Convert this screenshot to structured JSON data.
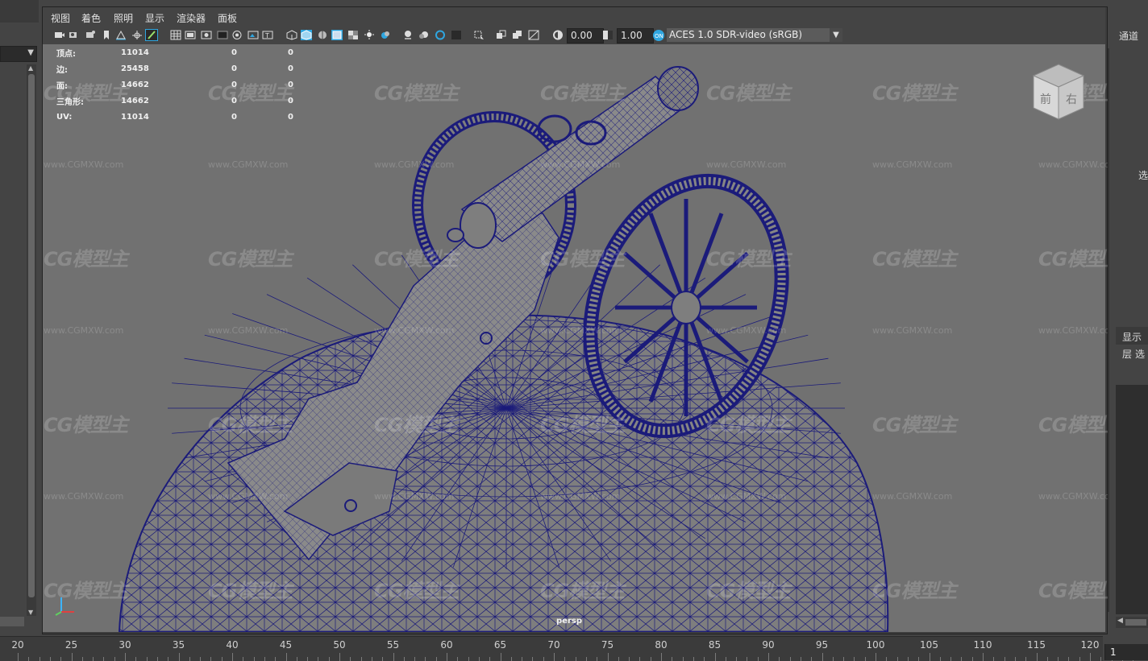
{
  "menu": [
    "视图",
    "着色",
    "照明",
    "显示",
    "渲染器",
    "面板"
  ],
  "toolbar": {
    "exposure": "0.00",
    "gamma": "1.00",
    "color_space": "ACES 1.0 SDR-video (sRGB)",
    "icons": [
      "camera-icon",
      "camera-attr-icon",
      "camera-bookmark-icon",
      "bookmark-icon",
      "image-plane-icon",
      "pivot-icon",
      "grease-pencil-icon",
      "grid-icon",
      "film-gate-icon",
      "resolution-gate-icon",
      "gate-mask-icon",
      "field-chart-icon",
      "safe-action-icon",
      "safe-title-icon",
      "wireframe-icon",
      "smooth-shade-icon",
      "wireframe-on-shaded-icon",
      "textured-icon",
      "use-all-lights-icon",
      "shadows-icon",
      "screen-space-ao-icon",
      "motion-blur-icon",
      "multisample-aa-icon",
      "depth-of-field-icon",
      "isolate-select-icon",
      "xray-icon",
      "xray-active-icon",
      "xray-joints-icon",
      "backface-icon",
      "exposure-icon",
      "gamma-icon",
      "color-management-icon"
    ]
  },
  "hud": {
    "rows": [
      {
        "label": "顶点:",
        "v1": "11014",
        "v2": "0",
        "v3": "0"
      },
      {
        "label": "边:",
        "v1": "25458",
        "v2": "0",
        "v3": "0"
      },
      {
        "label": "面:",
        "v1": "14662",
        "v2": "0",
        "v3": "0"
      },
      {
        "label": "三角形:",
        "v1": "14662",
        "v2": "0",
        "v3": "0"
      },
      {
        "label": "UV:",
        "v1": "11014",
        "v2": "0",
        "v3": "0"
      }
    ]
  },
  "viewport": {
    "camera_label": "persp"
  },
  "view_cube": {
    "front": "前",
    "right": "右"
  },
  "right_panel": {
    "channels": "通道",
    "select": "选",
    "display": "显示",
    "layer": "层",
    "layer_more": "选"
  },
  "timeline": {
    "ticks": [
      "20",
      "25",
      "30",
      "35",
      "40",
      "45",
      "50",
      "55",
      "60",
      "65",
      "70",
      "75",
      "80",
      "85",
      "90",
      "95",
      "100",
      "105",
      "110",
      "115",
      "120"
    ],
    "current_frame": "1"
  },
  "watermark": {
    "logo": "CG模型主",
    "url": "www.CGMXW.com"
  },
  "colors": {
    "wire": "#1b1b7a",
    "viewport_bg": "#717171",
    "panel_bg": "#444444",
    "active_icon": "#2fa6e0"
  }
}
